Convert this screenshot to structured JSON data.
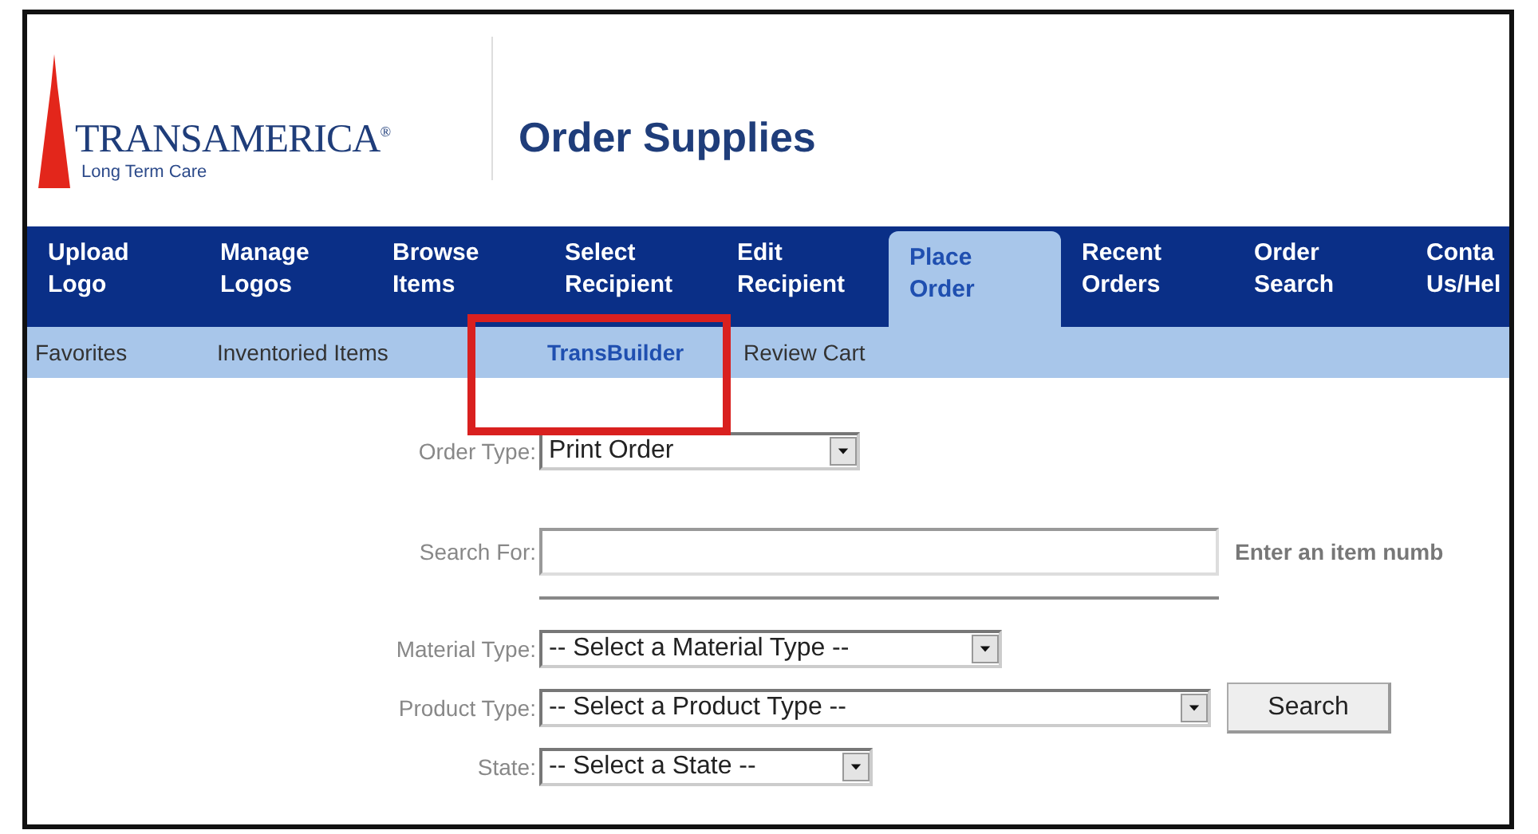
{
  "header": {
    "logo": {
      "brand": "TRANSAMERICA$^{®}$",
      "tagline": "Long Term Care"
    },
    "title": "Order Supplies"
  },
  "nav": [
    {
      "lines": [
        "Upload",
        "Logo"
      ],
      "selected": false
    },
    {
      "lines": [
        "Manage",
        "Logos"
      ],
      "selected": false
    },
    {
      "lines": [
        "Browse",
        "Items"
      ],
      "selected": false
    },
    {
      "lines": [
        "Select",
        "Recipient"
      ],
      "selected": false
    },
    {
      "lines": [
        "Edit",
        "Recipient"
      ],
      "selected": false
    },
    {
      "lines": [
        "Place",
        "Order"
      ],
      "selected": true
    },
    {
      "lines": [
        "Recent",
        "Orders"
      ],
      "selected": false
    },
    {
      "lines": [
        "Order",
        "Search"
      ],
      "selected": false
    },
    {
      "lines": [
        "Conta",
        "Us/Hel"
      ],
      "selected": false
    }
  ],
  "subnav": [
    {
      "label": "Favorites",
      "selected": false
    },
    {
      "label": "Inventoried Items",
      "selected": false
    },
    {
      "label": "TransBuilder",
      "selected": true
    },
    {
      "label": "Review Cart",
      "selected": false
    }
  ],
  "form": {
    "order_type": {
      "label": "Order Type:",
      "value": "Print Order"
    },
    "search_for": {
      "label": "Search For:",
      "hint": "Enter an item numb"
    },
    "material_type": {
      "label": "Material Type:",
      "value": "-- Select a Material Type --"
    },
    "product_type": {
      "label": "Product Type:",
      "value": "-- Select a Product Type --"
    },
    "search_button": "Search",
    "state": {
      "label": "State:",
      "value": "-- Select a State --"
    }
  },
  "highlight": {
    "shown": true
  }
}
